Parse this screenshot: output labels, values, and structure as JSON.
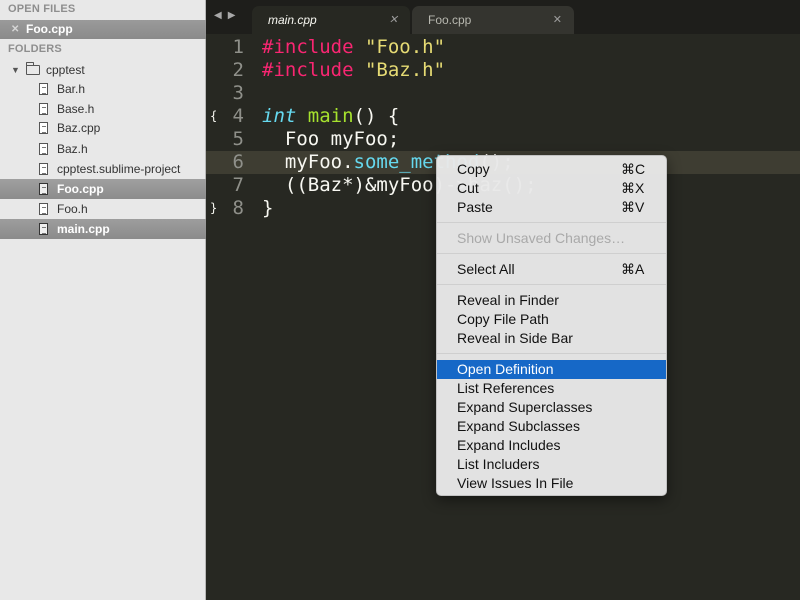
{
  "sidebar": {
    "open_files_header": "OPEN FILES",
    "open_files": [
      {
        "close_glyph": "✕",
        "name": "Foo.cpp"
      }
    ],
    "folders_header": "FOLDERS",
    "root_folder": "cpptest",
    "files": [
      {
        "name": "Bar.h"
      },
      {
        "name": "Base.h"
      },
      {
        "name": "Baz.cpp"
      },
      {
        "name": "Baz.h"
      },
      {
        "name": "cpptest.sublime-project"
      },
      {
        "name": "Foo.cpp"
      },
      {
        "name": "Foo.h"
      },
      {
        "name": "main.cpp"
      }
    ]
  },
  "tabbar": {
    "back_glyph": "◀",
    "forward_glyph": "▶",
    "tabs": [
      {
        "title": "main.cpp",
        "active": true
      },
      {
        "title": "Foo.cpp",
        "active": false
      }
    ],
    "close_glyph": "✕"
  },
  "editor": {
    "line_numbers": [
      "1",
      "2",
      "3",
      "4",
      "5",
      "6",
      "7",
      "8"
    ],
    "fold_open": "{",
    "fold_close": "}",
    "lines": [
      {
        "t1": "#include",
        "t2": " \"Foo.h\""
      },
      {
        "t1": "#include",
        "t2": " \"Baz.h\""
      },
      {},
      {
        "t1": "int",
        "t2": " ",
        "t3": "main",
        "t4": "() {"
      },
      {
        "t1": "  Foo myFoo;"
      },
      {
        "t1": "  myFoo.",
        "t2": "some_method",
        "t3": "();"
      },
      {
        "t1": "  ((Baz*)&myFoo)->baz();"
      },
      {
        "t1": "}"
      }
    ]
  },
  "context_menu": {
    "items": [
      {
        "label": "Copy",
        "shortcut": "⌘C",
        "state": "normal"
      },
      {
        "label": "Cut",
        "shortcut": "⌘X",
        "state": "normal"
      },
      {
        "label": "Paste",
        "shortcut": "⌘V",
        "state": "normal"
      },
      {
        "label": "Show Unsaved Changes…",
        "shortcut": "",
        "state": "disabled"
      },
      {
        "label": "Select All",
        "shortcut": "⌘A",
        "state": "normal"
      },
      {
        "label": "Reveal in Finder",
        "shortcut": "",
        "state": "normal"
      },
      {
        "label": "Copy File Path",
        "shortcut": "",
        "state": "normal"
      },
      {
        "label": "Reveal in Side Bar",
        "shortcut": "",
        "state": "normal"
      },
      {
        "label": "Open Definition",
        "shortcut": "",
        "state": "highlighted"
      },
      {
        "label": "List References",
        "shortcut": "",
        "state": "normal"
      },
      {
        "label": "Expand Superclasses",
        "shortcut": "",
        "state": "normal"
      },
      {
        "label": "Expand Subclasses",
        "shortcut": "",
        "state": "normal"
      },
      {
        "label": "Expand Includes",
        "shortcut": "",
        "state": "normal"
      },
      {
        "label": "List Includers",
        "shortcut": "",
        "state": "normal"
      },
      {
        "label": "View Issues In File",
        "shortcut": "",
        "state": "normal"
      }
    ]
  },
  "colors": {
    "editor_bg": "#272822",
    "keyword": "#f92672",
    "string": "#e6db74",
    "type": "#66d9ef",
    "function": "#a6e22e",
    "menu_highlight": "#1668c7"
  }
}
